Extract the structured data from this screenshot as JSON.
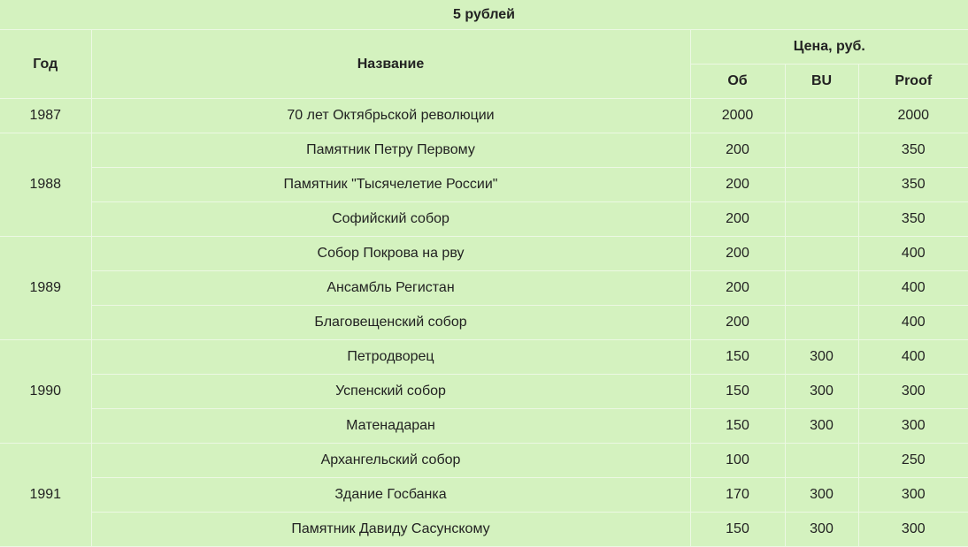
{
  "table": {
    "caption": "5 рублей",
    "headers": {
      "year": "Год",
      "name": "Название",
      "price": "Цена, руб.",
      "ob": "Об",
      "bu": "BU",
      "proof": "Proof"
    },
    "groups": [
      {
        "year": "1987",
        "rows": [
          {
            "name": "70 лет Октябрьской революции",
            "ob": "2000",
            "bu": "",
            "proof": "2000"
          }
        ]
      },
      {
        "year": "1988",
        "rows": [
          {
            "name": "Памятник Петру Первому",
            "ob": "200",
            "bu": "",
            "proof": "350"
          },
          {
            "name": "Памятник \"Тысячелетие России\"",
            "ob": "200",
            "bu": "",
            "proof": "350"
          },
          {
            "name": "Софийский собор",
            "ob": "200",
            "bu": "",
            "proof": "350"
          }
        ]
      },
      {
        "year": "1989",
        "rows": [
          {
            "name": "Собор Покрова на рву",
            "ob": "200",
            "bu": "",
            "proof": "400"
          },
          {
            "name": "Ансамбль Регистан",
            "ob": "200",
            "bu": "",
            "proof": "400"
          },
          {
            "name": "Благовещенский собор",
            "ob": "200",
            "bu": "",
            "proof": "400"
          }
        ]
      },
      {
        "year": "1990",
        "rows": [
          {
            "name": "Петродворец",
            "ob": "150",
            "bu": "300",
            "proof": "400"
          },
          {
            "name": "Успенский собор",
            "ob": "150",
            "bu": "300",
            "proof": "300"
          },
          {
            "name": "Матенадаран",
            "ob": "150",
            "bu": "300",
            "proof": "300"
          }
        ]
      },
      {
        "year": "1991",
        "rows": [
          {
            "name": "Архангельский собор",
            "ob": "100",
            "bu": "",
            "proof": "250"
          },
          {
            "name": "Здание Госбанка",
            "ob": "170",
            "bu": "300",
            "proof": "300"
          },
          {
            "name": "Памятник Давиду Сасунскому",
            "ob": "150",
            "bu": "300",
            "proof": "300"
          }
        ]
      }
    ]
  }
}
